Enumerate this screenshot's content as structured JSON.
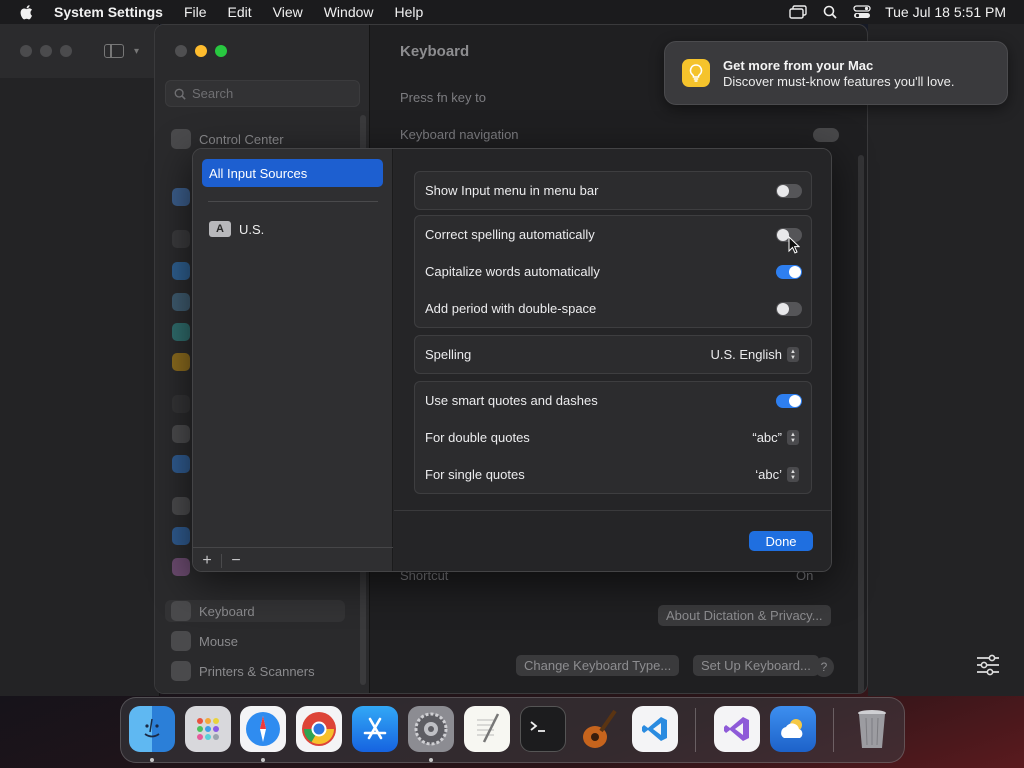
{
  "menubar": {
    "app_name": "System Settings",
    "menus": [
      "File",
      "Edit",
      "View",
      "Window",
      "Help"
    ],
    "clock": "Tue Jul 18  5:51 PM"
  },
  "notification": {
    "title": "Get more from your Mac",
    "body": "Discover must-know features you'll love."
  },
  "settings": {
    "search_placeholder": "Search",
    "sidebar_items": {
      "control_center": "Control Center",
      "keyboard": "Keyboard",
      "mouse": "Mouse",
      "printers": "Printers & Scanners"
    },
    "pane_title": "Keyboard",
    "rows": {
      "press_fn": "Press fn key to",
      "keyboard_navigation": "Keyboard navigation",
      "shortcut": "Shortcut",
      "shortcut_value": "On"
    },
    "buttons": {
      "about_dictation": "About Dictation & Privacy...",
      "change_type": "Change Keyboard Type...",
      "set_up": "Set Up Keyboard...",
      "help": "?"
    }
  },
  "sheet": {
    "sources": {
      "all": "All Input Sources",
      "us_badge": "A",
      "us": "U.S."
    },
    "footer": {
      "add": "+",
      "remove": "−"
    },
    "show_input_menu": {
      "label": "Show Input menu in menu bar",
      "on": false
    },
    "correct_spelling": {
      "label": "Correct spelling automatically",
      "on": false
    },
    "capitalize": {
      "label": "Capitalize words automatically",
      "on": true
    },
    "period": {
      "label": "Add period with double-space",
      "on": false
    },
    "spelling": {
      "label": "Spelling",
      "value": "U.S. English"
    },
    "smart_quotes": {
      "label": "Use smart quotes and dashes",
      "on": true
    },
    "double_quotes": {
      "label": "For double quotes",
      "value": "“abc”"
    },
    "single_quotes": {
      "label": "For single quotes",
      "value": "‘abc’"
    },
    "done": "Done"
  },
  "dock": {
    "apps": [
      "finder-icon",
      "launchpad-icon",
      "safari-icon",
      "chrome-icon",
      "app-store-icon",
      "system-settings-icon",
      "textedit-icon",
      "terminal-icon",
      "garageband-icon",
      "vscode-icon",
      "visual-studio-icon",
      "weather-icon",
      "trash-icon"
    ]
  },
  "colors": {
    "accent": "#1f6fe0",
    "toggle_on": "#2e7ff0",
    "notification_bulb": "#f5c32c"
  }
}
